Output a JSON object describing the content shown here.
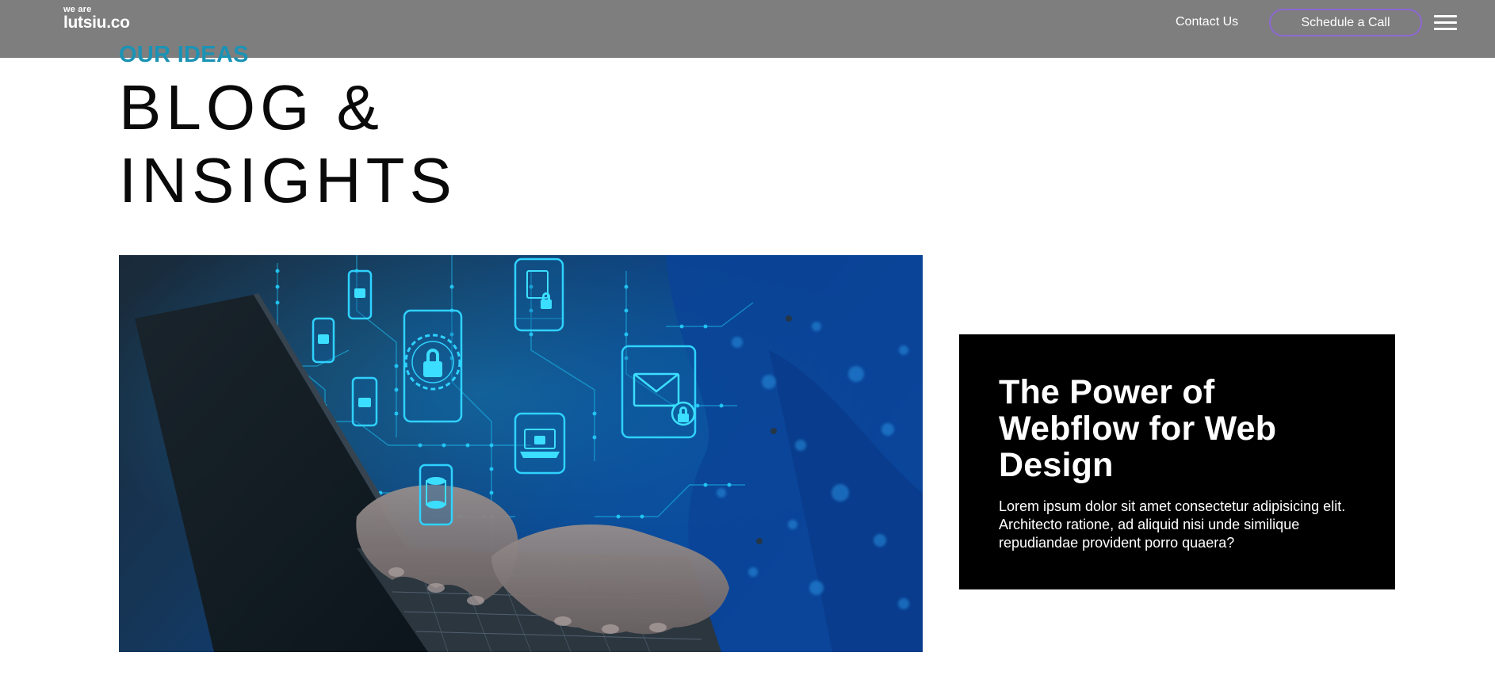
{
  "header": {
    "logo_small": "we are",
    "logo_main": "lutsiu.co",
    "nav_contact": "Contact Us",
    "cta_label": "Schedule a Call",
    "menu_icon": "hamburger-menu-icon",
    "background_color": "#7e7e7e",
    "cta_border_color": "#8e68d2"
  },
  "hero": {
    "eyebrow": "OUR IDEAS",
    "title_line1": "BLOG &",
    "title_line2": "INSIGHTS",
    "eyebrow_color": "#1b93b5"
  },
  "featured_post": {
    "image_subject": "hands-typing-on-laptop-with-cybersecurity-icons",
    "title": "The Power of Webflow for Web Design",
    "excerpt": "Lorem ipsum dolor sit amet consectetur adipisicing elit. Architecto ratione, ad aliquid nisi unde similique repudiandae provident porro quaera?",
    "card_color": "#000000"
  },
  "icons": {
    "padlock": "padlock-icon",
    "document_lock": "document-lock-icon",
    "envelope_lock": "envelope-lock-icon",
    "laptop_lock": "laptop-lock-icon",
    "database": "database-icon"
  }
}
